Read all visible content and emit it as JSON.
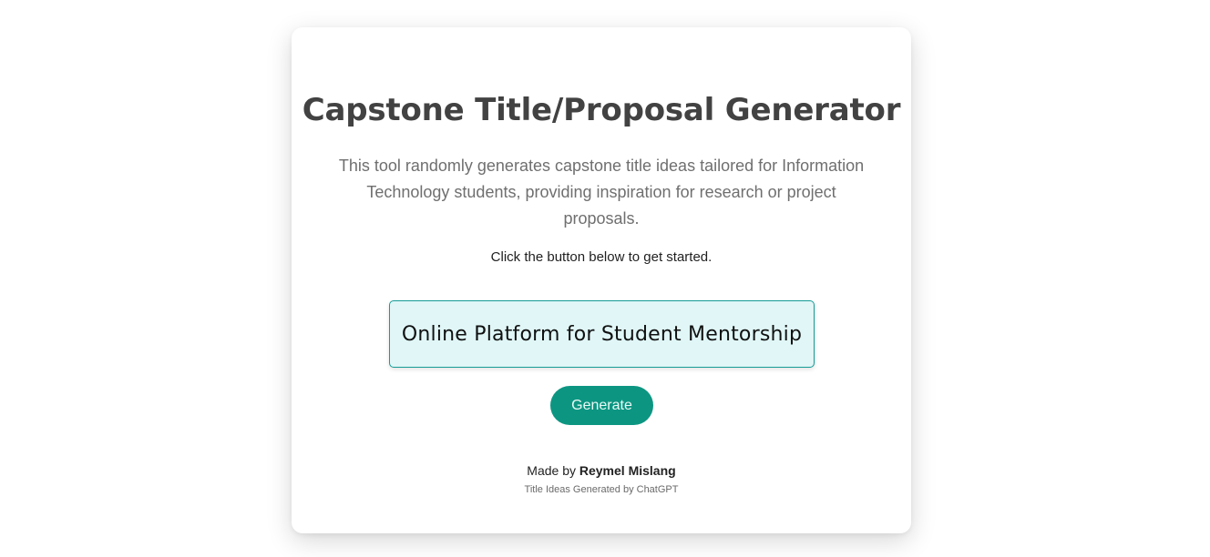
{
  "card": {
    "title": "Capstone Title/Proposal Generator",
    "description": "This tool randomly generates capstone title ideas tailored for Information Technology students, providing inspiration for research or project proposals.",
    "instruction": "Click the button below to get started.",
    "generated_title": "Online Platform for Student Mentorship",
    "generate_button_label": "Generate",
    "footer": {
      "made_by_prefix": "Made by",
      "author": "Reymel Mislang",
      "note": "Title Ideas Generated by ChatGPT"
    }
  },
  "colors": {
    "accent": "#0c9682",
    "result_background": "#e0f6f7",
    "result_border": "#179c96",
    "title_text": "#424242"
  }
}
